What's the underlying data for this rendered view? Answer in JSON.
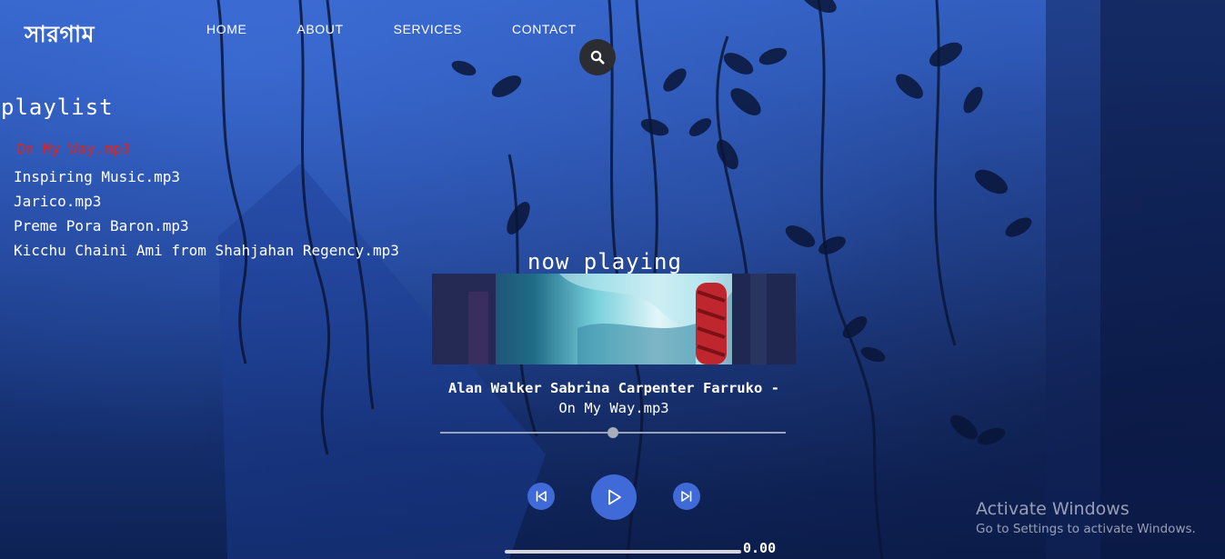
{
  "brand": {
    "logo": "সারগাম"
  },
  "nav": [
    {
      "label": "HOME"
    },
    {
      "label": "ABOUT"
    },
    {
      "label": "SERVICES"
    },
    {
      "label": "CONTACT"
    }
  ],
  "search": {
    "icon": "search-icon"
  },
  "playlist": {
    "title": "playlist",
    "items": [
      {
        "label": "On My Way.mp3",
        "active": true
      },
      {
        "label": "Inspiring Music.mp3"
      },
      {
        "label": "Jarico.mp3"
      },
      {
        "label": "Preme Pora Baron.mp3"
      },
      {
        "label": "Kicchu Chaini Ami from Shahjahan Regency.mp3"
      }
    ]
  },
  "player": {
    "heading": "now playing",
    "artist": "Alan Walker Sabrina Carpenter Farruko -",
    "track": "On My Way.mp3",
    "progress_fraction": 0.5,
    "time": "0.00",
    "controls": {
      "prev_icon": "skip-previous-icon",
      "play_icon": "play-icon",
      "next_icon": "skip-next-icon"
    }
  },
  "watermark": {
    "line1": "Activate Windows",
    "line2": "Go to Settings to activate Windows."
  },
  "colors": {
    "accent": "#3f6ad8",
    "active_track": "#e2231a",
    "search_bg": "#2b2d33"
  }
}
